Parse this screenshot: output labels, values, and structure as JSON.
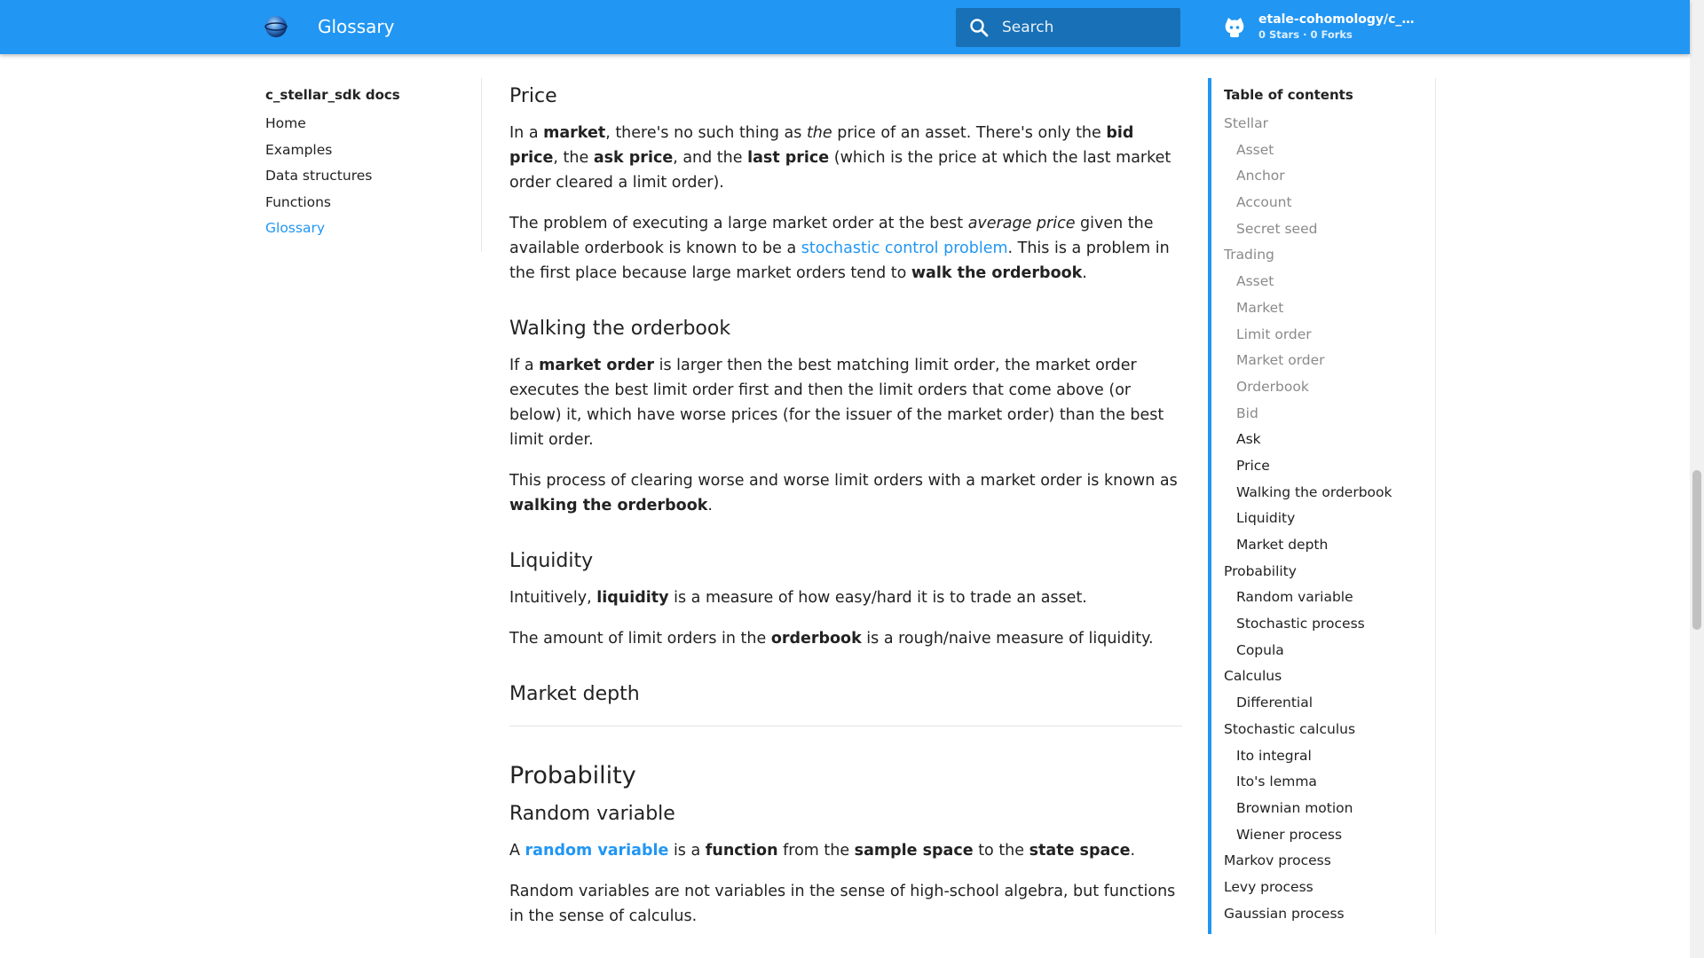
{
  "header": {
    "title": "Glossary",
    "search_placeholder": "Search",
    "repo_name": "etale-cohomology/c_st...",
    "repo_facts": "0 Stars · 0 Forks",
    "icons": {
      "logo": "sphere-logo",
      "search": "search-icon",
      "repo": "github-octocat-icon"
    },
    "brand_color": "#2196f3"
  },
  "leftnav": {
    "title": "c_stellar_sdk docs",
    "items": [
      "Home",
      "Examples",
      "Data structures",
      "Functions",
      "Glossary"
    ],
    "active": "Glossary"
  },
  "content": {
    "price": {
      "heading": "Price",
      "p1": {
        "t1": "In a ",
        "b1": "market",
        "t2": ", there's no such thing as ",
        "i1": "the",
        "t3": " price of an asset. There's only the ",
        "b2": "bid price",
        "t4": ", the ",
        "b3": "ask price",
        "t5": ", and the ",
        "b4": "last price",
        "t6": " (which is the price at which the last market order cleared a limit order)."
      },
      "p2": {
        "t1": "The problem of executing a large market order at the best ",
        "i1": "average price",
        "t2": " given the available orderbook is known to be a ",
        "link": "stochastic control problem",
        "t3": ". This is a problem in the first place because large market orders tend to ",
        "b1": "walk the orderbook",
        "t4": "."
      }
    },
    "walking": {
      "heading": "Walking the orderbook",
      "p1": {
        "t1": "If a ",
        "b1": "market order",
        "t2": " is larger then the best matching limit order, the market order executes the best limit order first and then the limit orders that come above (or below) it, which have worse prices (for the issuer of the market order) than the best limit order."
      },
      "p2": {
        "t1": "This process of clearing worse and worse limit orders with a market order is known as ",
        "b1": "walking the orderbook",
        "t2": "."
      }
    },
    "liquidity": {
      "heading": "Liquidity",
      "p1": {
        "t1": "Intuitively, ",
        "b1": "liquidity",
        "t2": " is a measure of how easy/hard it is to trade an asset."
      },
      "p2": {
        "t1": "The amount of limit orders in the ",
        "b1": "orderbook",
        "t2": " is a rough/naive measure of liquidity."
      }
    },
    "market_depth": {
      "heading": "Market depth"
    },
    "probability": {
      "heading": "Probability",
      "random_variable": {
        "heading": "Random variable",
        "p1": {
          "t1": "A ",
          "link": "random variable",
          "t2": " is a ",
          "b1": "function",
          "t3": " from the ",
          "b2": "sample space",
          "t4": " to the ",
          "b3": "state space",
          "t5": "."
        },
        "p2": "Random variables are not variables in the sense of high-school algebra, but functions in the sense of calculus."
      }
    }
  },
  "toc": {
    "title": "Table of contents",
    "items": [
      {
        "label": "Stellar",
        "level": 1,
        "state": "muted"
      },
      {
        "label": "Asset",
        "level": 2,
        "state": "muted"
      },
      {
        "label": "Anchor",
        "level": 2,
        "state": "muted"
      },
      {
        "label": "Account",
        "level": 2,
        "state": "muted"
      },
      {
        "label": "Secret seed",
        "level": 2,
        "state": "muted"
      },
      {
        "label": "Trading",
        "level": 1,
        "state": "muted"
      },
      {
        "label": "Asset",
        "level": 2,
        "state": "muted"
      },
      {
        "label": "Market",
        "level": 2,
        "state": "muted"
      },
      {
        "label": "Limit order",
        "level": 2,
        "state": "muted"
      },
      {
        "label": "Market order",
        "level": 2,
        "state": "muted"
      },
      {
        "label": "Orderbook",
        "level": 2,
        "state": "muted"
      },
      {
        "label": "Bid",
        "level": 2,
        "state": "muted"
      },
      {
        "label": "Ask",
        "level": 2,
        "state": "dark"
      },
      {
        "label": "Price",
        "level": 2,
        "state": "dark"
      },
      {
        "label": "Walking the orderbook",
        "level": 2,
        "state": "dark"
      },
      {
        "label": "Liquidity",
        "level": 2,
        "state": "dark"
      },
      {
        "label": "Market depth",
        "level": 2,
        "state": "dark"
      },
      {
        "label": "Probability",
        "level": 1,
        "state": "dark"
      },
      {
        "label": "Random variable",
        "level": 2,
        "state": "dark"
      },
      {
        "label": "Stochastic process",
        "level": 2,
        "state": "dark"
      },
      {
        "label": "Copula",
        "level": 2,
        "state": "dark"
      },
      {
        "label": "Calculus",
        "level": 1,
        "state": "dark"
      },
      {
        "label": "Differential",
        "level": 2,
        "state": "dark"
      },
      {
        "label": "Stochastic calculus",
        "level": 1,
        "state": "dark"
      },
      {
        "label": "Ito integral",
        "level": 2,
        "state": "dark"
      },
      {
        "label": "Ito's lemma",
        "level": 2,
        "state": "dark"
      },
      {
        "label": "Brownian motion",
        "level": 2,
        "state": "dark"
      },
      {
        "label": "Wiener process",
        "level": 2,
        "state": "dark"
      },
      {
        "label": "Markov process",
        "level": 1,
        "state": "dark"
      },
      {
        "label": "Levy process",
        "level": 1,
        "state": "dark"
      },
      {
        "label": "Gaussian process",
        "level": 1,
        "state": "dark"
      }
    ]
  }
}
